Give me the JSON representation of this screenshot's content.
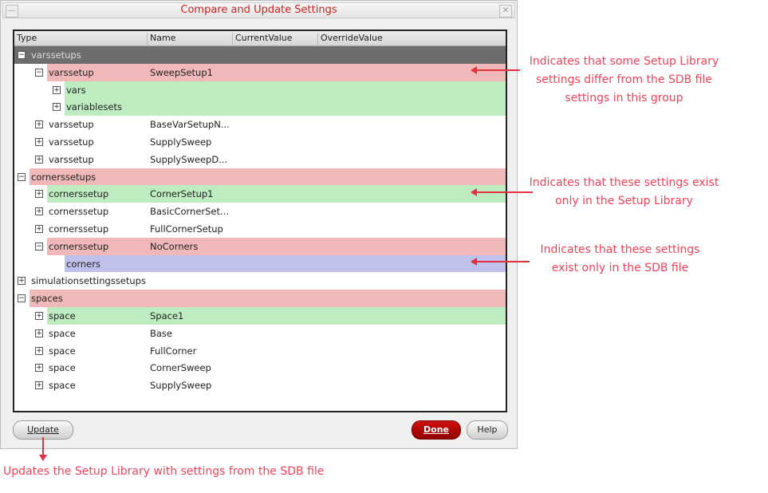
{
  "window": {
    "title": "Compare and Update Settings",
    "minimize_icon": "—",
    "close_icon": "✕"
  },
  "columns": [
    "Type",
    "Name",
    "CurrentValue",
    "OverrideValue"
  ],
  "colors": {
    "differ": "#f0b8b8",
    "library_only": "#bdecc0",
    "sdb_only": "#c0c0ec",
    "group_header": "#6d6d6d"
  },
  "rows": [
    {
      "type": "varssetups",
      "name": "",
      "level": 0,
      "exp": "minus",
      "status": "header"
    },
    {
      "type": "varssetup",
      "name": "SweepSetup1",
      "level": 1,
      "exp": "minus",
      "status": "differ"
    },
    {
      "type": "vars",
      "name": "",
      "level": 2,
      "exp": "plus",
      "status": "library_only"
    },
    {
      "type": "variablesets",
      "name": "",
      "level": 2,
      "exp": "plus",
      "status": "library_only"
    },
    {
      "type": "varssetup",
      "name": "BaseVarSetupN...",
      "level": 1,
      "exp": "plus",
      "status": ""
    },
    {
      "type": "varssetup",
      "name": "SupplySweep",
      "level": 1,
      "exp": "plus",
      "status": ""
    },
    {
      "type": "varssetup",
      "name": "SupplySweepD...",
      "level": 1,
      "exp": "plus",
      "status": ""
    },
    {
      "type": "cornerssetups",
      "name": "",
      "level": 0,
      "exp": "minus",
      "status": "differ"
    },
    {
      "type": "cornerssetup",
      "name": "CornerSetup1",
      "level": 1,
      "exp": "plus",
      "status": "library_only"
    },
    {
      "type": "cornerssetup",
      "name": "BasicCornerSet...",
      "level": 1,
      "exp": "plus",
      "status": ""
    },
    {
      "type": "cornerssetup",
      "name": "FullCornerSetup",
      "level": 1,
      "exp": "plus",
      "status": ""
    },
    {
      "type": "cornerssetup",
      "name": "NoCorners",
      "level": 1,
      "exp": "minus",
      "status": "differ"
    },
    {
      "type": "corners",
      "name": "",
      "level": 2,
      "exp": "",
      "status": "sdb_only"
    },
    {
      "type": "simulationsettingssetups",
      "name": "",
      "level": 0,
      "exp": "plus",
      "status": ""
    },
    {
      "type": "spaces",
      "name": "",
      "level": 0,
      "exp": "minus",
      "status": "differ"
    },
    {
      "type": "space",
      "name": "Space1",
      "level": 1,
      "exp": "plus",
      "status": "library_only"
    },
    {
      "type": "space",
      "name": "Base",
      "level": 1,
      "exp": "plus",
      "status": ""
    },
    {
      "type": "space",
      "name": "FullCorner",
      "level": 1,
      "exp": "plus",
      "status": ""
    },
    {
      "type": "space",
      "name": "CornerSweep",
      "level": 1,
      "exp": "plus",
      "status": ""
    },
    {
      "type": "space",
      "name": "SupplySweep",
      "level": 1,
      "exp": "plus",
      "status": ""
    }
  ],
  "buttons": {
    "update": "Update",
    "done": "Done",
    "help": "Help"
  },
  "annotations": {
    "differ": "Indicates that some Setup Library settings differ from the SDB file settings in this group",
    "library_only": "Indicates that these settings exist only in the Setup Library",
    "sdb_only": "Indicates that these settings exist only in the SDB file",
    "update": "Updates the Setup Library with settings from the SDB file"
  }
}
